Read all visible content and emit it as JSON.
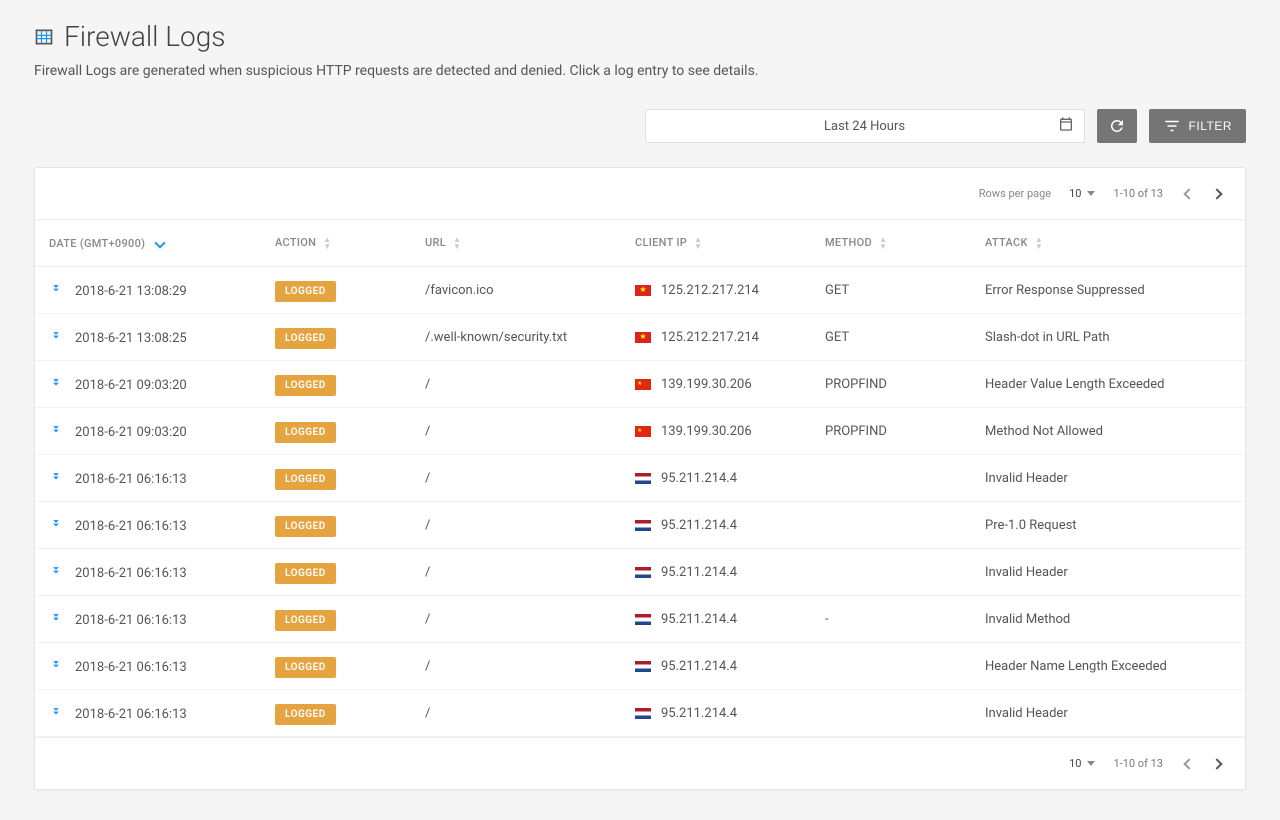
{
  "pageTitle": "Firewall Logs",
  "subtitle": "Firewall Logs are generated when suspicious HTTP requests are detected and denied. Click a log entry to see details.",
  "toolbar": {
    "dateRangeLabel": "Last 24 Hours",
    "filterLabel": "FILTER"
  },
  "pager": {
    "rowsPerPageLabel": "Rows per page",
    "rowsPerPageValue": "10",
    "rangeText": "1-10 of 13"
  },
  "columns": {
    "date": "DATE (GMT+0900)",
    "action": "ACTION",
    "url": "URL",
    "clientIp": "CLIENT IP",
    "method": "METHOD",
    "attack": "ATTACK"
  },
  "rows": [
    {
      "date": "2018-6-21 13:08:29",
      "action": "LOGGED",
      "url": "/favicon.ico",
      "flag": "vn",
      "ip": "125.212.217.214",
      "method": "GET",
      "attack": "Error Response Suppressed"
    },
    {
      "date": "2018-6-21 13:08:25",
      "action": "LOGGED",
      "url": "/.well-known/security.txt",
      "flag": "vn",
      "ip": "125.212.217.214",
      "method": "GET",
      "attack": "Slash-dot in URL Path"
    },
    {
      "date": "2018-6-21 09:03:20",
      "action": "LOGGED",
      "url": "/",
      "flag": "cn",
      "ip": "139.199.30.206",
      "method": "PROPFIND",
      "attack": "Header Value Length Exceeded"
    },
    {
      "date": "2018-6-21 09:03:20",
      "action": "LOGGED",
      "url": "/",
      "flag": "cn",
      "ip": "139.199.30.206",
      "method": "PROPFIND",
      "attack": "Method Not Allowed"
    },
    {
      "date": "2018-6-21 06:16:13",
      "action": "LOGGED",
      "url": "/",
      "flag": "nl",
      "ip": "95.211.214.4",
      "method": "",
      "attack": "Invalid Header"
    },
    {
      "date": "2018-6-21 06:16:13",
      "action": "LOGGED",
      "url": "/",
      "flag": "nl",
      "ip": "95.211.214.4",
      "method": "",
      "attack": "Pre-1.0 Request"
    },
    {
      "date": "2018-6-21 06:16:13",
      "action": "LOGGED",
      "url": "/",
      "flag": "nl",
      "ip": "95.211.214.4",
      "method": "",
      "attack": "Invalid Header"
    },
    {
      "date": "2018-6-21 06:16:13",
      "action": "LOGGED",
      "url": "/",
      "flag": "nl",
      "ip": "95.211.214.4",
      "method": "-",
      "attack": "Invalid Method"
    },
    {
      "date": "2018-6-21 06:16:13",
      "action": "LOGGED",
      "url": "/",
      "flag": "nl",
      "ip": "95.211.214.4",
      "method": "",
      "attack": "Header Name Length Exceeded"
    },
    {
      "date": "2018-6-21 06:16:13",
      "action": "LOGGED",
      "url": "/",
      "flag": "nl",
      "ip": "95.211.214.4",
      "method": "",
      "attack": "Invalid Header"
    }
  ]
}
